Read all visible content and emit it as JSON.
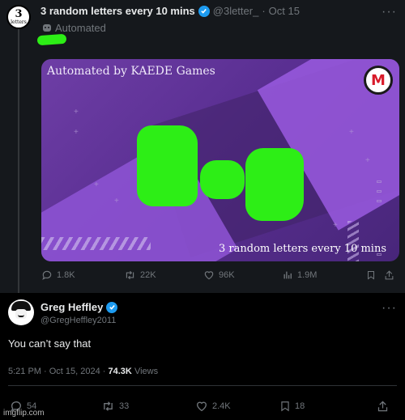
{
  "quoted_tweet": {
    "display_name": "3 random letters every 10 mins",
    "handle": "@3letter_",
    "separator": "·",
    "date": "Oct 15",
    "automated_label": "Automated",
    "avatar": {
      "number": "3",
      "label": "letters"
    },
    "media": {
      "title": "Automated by KAEDE Games",
      "subtitle": "3 random letters every 10 mins",
      "logo_mark": "M"
    },
    "actions": {
      "replies": "1.8K",
      "retweets": "22K",
      "likes": "96K",
      "views": "1.9M"
    }
  },
  "reply_tweet": {
    "display_name": "Greg Heffley",
    "handle": "@GregHeffley2011",
    "text": "You can’t say that",
    "timestamp": "5:21 PM · Oct 15, 2024 ·",
    "views_count": "74.3K",
    "views_label": "Views",
    "actions": {
      "replies": "54",
      "retweets": "33",
      "likes": "2.4K",
      "bookmarks": "18"
    }
  },
  "watermark": "imgflip.com",
  "colors": {
    "verified": "#1d9bf0",
    "muted": "#71767b",
    "scribble": "#2dee16",
    "media_purple": "#6e3ea6"
  },
  "icons": [
    "more-icon",
    "verified-badge-icon",
    "robot-icon",
    "reply-icon",
    "retweet-icon",
    "like-icon",
    "views-icon",
    "bookmark-icon",
    "share-icon"
  ]
}
